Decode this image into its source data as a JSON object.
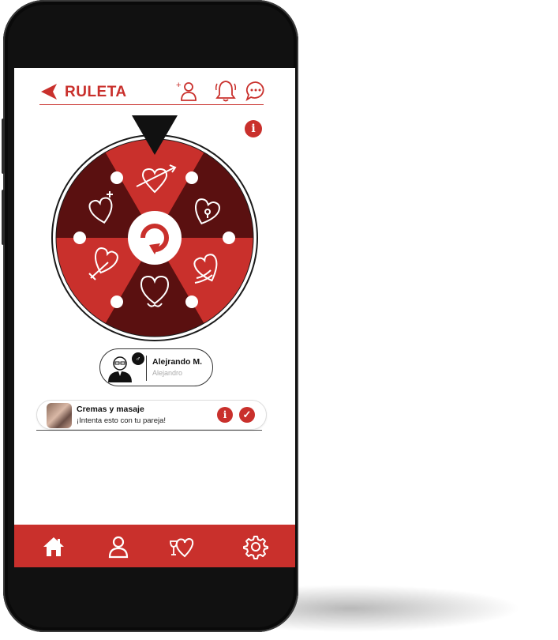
{
  "header": {
    "title": "RULETA",
    "add_user_label": "+"
  },
  "wheel": {
    "colors": {
      "light": "#c9302c",
      "dark": "#5a1010",
      "ring": "#ffffff",
      "hub": "#ffffff"
    },
    "segments": [
      {
        "icon": "heart-arrow-icon",
        "tone": "light"
      },
      {
        "icon": "locked-heart-icon",
        "tone": "dark"
      },
      {
        "icon": "winged-heart-icon",
        "tone": "light"
      },
      {
        "icon": "flaming-heart-icon",
        "tone": "dark"
      },
      {
        "icon": "dagger-heart-icon",
        "tone": "light"
      },
      {
        "icon": "sparkle-heart-icon",
        "tone": "dark"
      }
    ]
  },
  "info_top": {
    "label": "i"
  },
  "profile": {
    "name": "Alejrando M.",
    "username": "Alejandro",
    "gender_symbol": "♂"
  },
  "challenge": {
    "title": "Cremas y masaje",
    "subtitle": "¡Intenta esto con tu pareja!",
    "info_label": "i",
    "accept_label": "✓"
  },
  "nav": {
    "items": [
      "home-icon",
      "profile-icon",
      "couple-heart-icon",
      "settings-icon"
    ]
  },
  "accent": "#c9302c"
}
